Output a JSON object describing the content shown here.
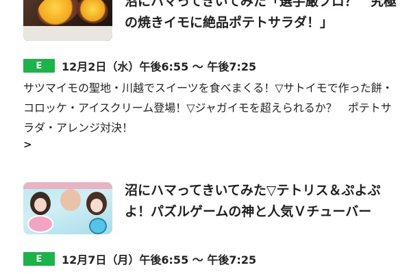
{
  "programs": [
    {
      "title": "沼にハマってきいてみた「選手厳ブロ？　究極の焼きイモに絶品ポテトサラダ！」",
      "channel_badge": "E",
      "airtime": "12月2日（水）午後6:55 〜 午後7:25",
      "description": "サツマイモの聖地・川越でスイーツを食べまくる！▽サトイモで作った餅・コロッケ・アイスクリーム登場！▽ジャガイモを超えられるか？　ポテトサラダ・アレンジ対決！",
      "more": ">"
    },
    {
      "title": "沼にハマってきいてみた▽テトリス＆ぷよぷよ！パズルゲームの神と人気Ｖチューバー",
      "channel_badge": "E",
      "airtime": "12月7日（月）午後6:55 〜 午後7:25"
    }
  ],
  "colors": {
    "channel_badge": "#1bb34a",
    "text": "#222222",
    "background": "#ffffff"
  }
}
